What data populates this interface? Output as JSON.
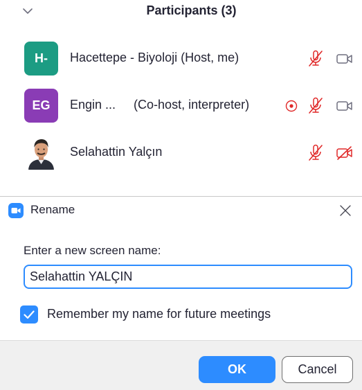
{
  "participants_panel": {
    "title": "Participants (3)",
    "collapse_icon": "chevron-down-icon",
    "participants": [
      {
        "initials": "H-",
        "name": "Hacettepe - Biyoloji (Host, me)",
        "avatar_color": "#1c9c83",
        "mic_icon": "mic-muted-icon",
        "video_icon": "video-on-icon"
      },
      {
        "initials": "EG",
        "name_short": "Engin ...",
        "role": "(Co-host, interpreter)",
        "avatar_color": "#8a3cb5",
        "interpreter_icon": "interpretation-icon",
        "mic_icon": "mic-muted-icon",
        "video_icon": "video-on-icon"
      },
      {
        "avatar": "photo-avatar",
        "name": "Selahattin Yalçın",
        "mic_icon": "mic-muted-icon",
        "video_icon": "video-off-icon"
      }
    ]
  },
  "rename_dialog": {
    "title": "Rename",
    "app_icon": "zoom-app-icon",
    "close_icon": "close-icon",
    "prompt": "Enter a new screen name:",
    "input_value": "Selahattin YALÇIN",
    "remember_checked": true,
    "remember_label": "Remember my name for future meetings",
    "ok_label": "OK",
    "cancel_label": "Cancel"
  },
  "colors": {
    "accent": "#2d8cff",
    "muted_red": "#e02828",
    "text": "#232333"
  }
}
